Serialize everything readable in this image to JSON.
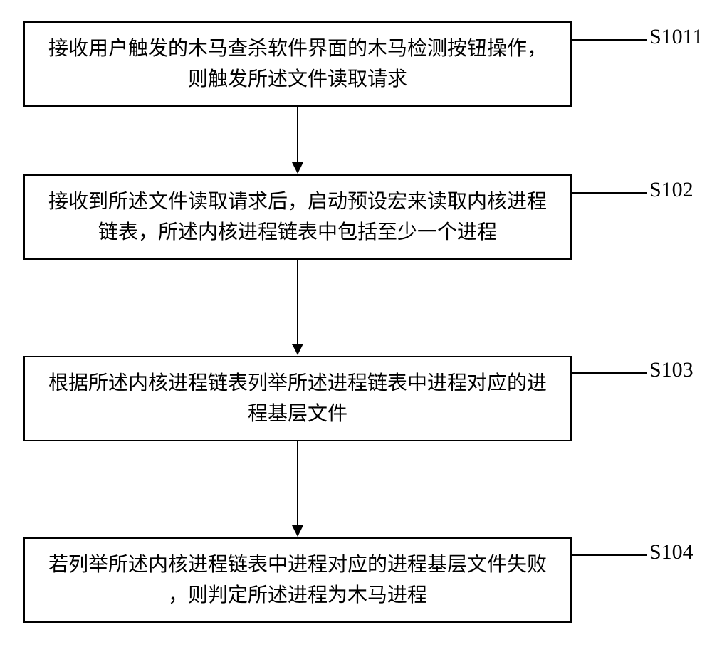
{
  "chart_data": {
    "type": "flowchart",
    "direction": "top-to-bottom",
    "nodes": [
      {
        "id": "S1011",
        "label": "S1011",
        "text": "接收用户触发的木马查杀软件界面的木马检测按钮操作，\n则触发所述文件读取请求"
      },
      {
        "id": "S102",
        "label": "S102",
        "text": "接收到所述文件读取请求后，启动预设宏来读取内核进程\n链表，所述内核进程链表中包括至少一个进程"
      },
      {
        "id": "S103",
        "label": "S103",
        "text": "根据所述内核进程链表列举所述进程链表中进程对应的进\n程基层文件"
      },
      {
        "id": "S104",
        "label": "S104",
        "text": "若列举所述内核进程链表中进程对应的进程基层文件失败\n，则判定所述进程为木马进程"
      }
    ],
    "edges": [
      {
        "from": "S1011",
        "to": "S102"
      },
      {
        "from": "S102",
        "to": "S103"
      },
      {
        "from": "S103",
        "to": "S104"
      }
    ]
  },
  "steps": {
    "s1011": {
      "label": "S1011",
      "text": "接收用户触发的木马查杀软件界面的木马检测按钮操作，\n则触发所述文件读取请求"
    },
    "s102": {
      "label": "S102",
      "text": "接收到所述文件读取请求后，启动预设宏来读取内核进程\n链表，所述内核进程链表中包括至少一个进程"
    },
    "s103": {
      "label": "S103",
      "text": "根据所述内核进程链表列举所述进程链表中进程对应的进\n程基层文件"
    },
    "s104": {
      "label": "S104",
      "text": "若列举所述内核进程链表中进程对应的进程基层文件失败\n，则判定所述进程为木马进程"
    }
  }
}
